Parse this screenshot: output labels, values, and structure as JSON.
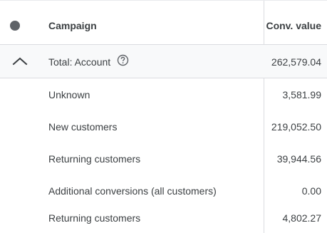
{
  "header": {
    "campaign_label": "Campaign",
    "conv_value_label": "Conv. value"
  },
  "total": {
    "label": "Total: Account",
    "value": "262,579.04"
  },
  "rows": [
    {
      "label": "Unknown",
      "value": "3,581.99"
    },
    {
      "label": "New customers",
      "value": "219,052.50"
    },
    {
      "label": "Returning customers",
      "value": "39,944.56"
    },
    {
      "label": "Additional conversions (all customers)",
      "value": "0.00"
    },
    {
      "label": "Returning customers",
      "value": "4,802.27"
    }
  ],
  "colors": {
    "status_dot": "#5f6368",
    "total_row_bg": "#f8f9fa",
    "divider": "#dadce0",
    "text": "#3c4043"
  },
  "icons": {
    "status": "status-dot-icon",
    "collapse": "chevron-up-icon",
    "help": "help-circle-icon"
  }
}
